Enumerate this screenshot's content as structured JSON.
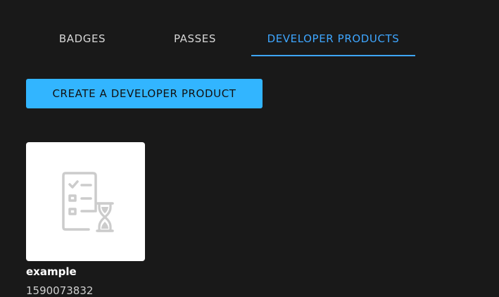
{
  "tabs": [
    {
      "label": "BADGES"
    },
    {
      "label": "PASSES"
    },
    {
      "label": "DEVELOPER PRODUCTS"
    }
  ],
  "active_tab": "DEVELOPER PRODUCTS",
  "create_button": {
    "label": "CREATE A DEVELOPER PRODUCT"
  },
  "products": [
    {
      "name": "example",
      "id": "1590073832",
      "icon": "checklist-hourglass-icon"
    }
  ],
  "colors": {
    "background": "#191919",
    "accent": "#3ea6ff",
    "button": "#32b5ff"
  }
}
